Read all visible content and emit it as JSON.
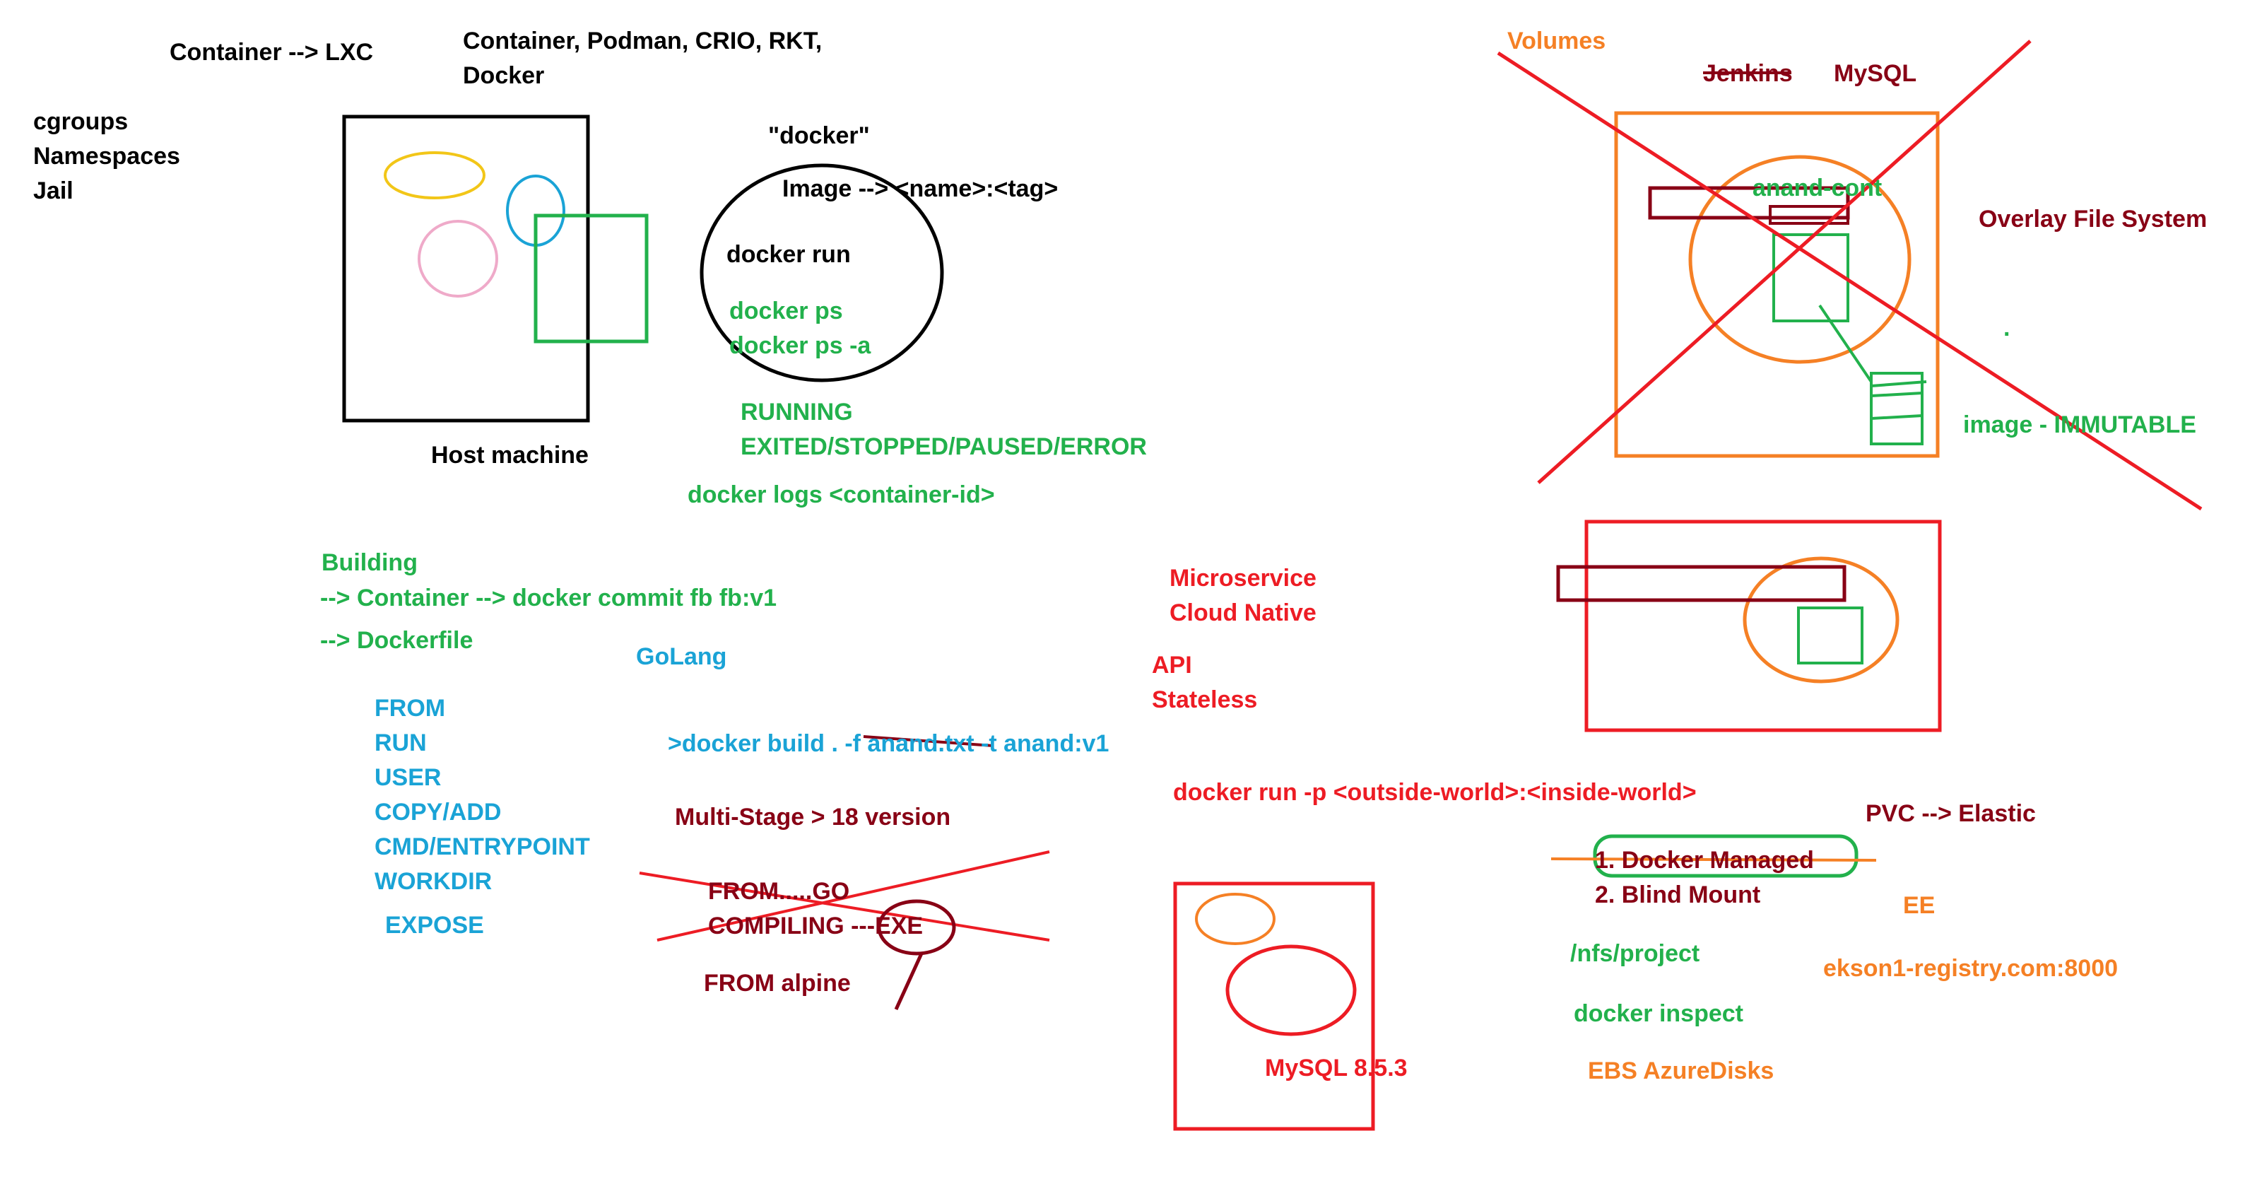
{
  "colors": {
    "black": "#000000",
    "green": "#22b14c",
    "blue": "#1aa3d6",
    "dark_red": "#880015",
    "red": "#ed1c24",
    "orange": "#f58025",
    "yellow": "#f2c618",
    "pink": "#efaac9"
  },
  "top_left": {
    "container_lxc": "Container --> LXC",
    "runtimes_line1": "Container, Podman, CRIO, RKT,",
    "runtimes_line2": "Docker",
    "kernel_features": [
      "cgroups",
      "Namespaces",
      "Jail"
    ],
    "host_machine": "Host machine"
  },
  "docker_basics": {
    "docker_quoted": "\"docker\"",
    "image_format": "Image --> <name>:<tag>",
    "docker_run": "docker run",
    "docker_ps": "docker ps",
    "docker_ps_a": "docker ps -a",
    "state_running": "RUNNING",
    "state_others": "EXITED/STOPPED/PAUSED/ERROR",
    "docker_logs": "docker logs <container-id>"
  },
  "building": {
    "heading": "Building",
    "via_commit": "--> Container --> docker commit fb fb:v1",
    "via_dockerfile": "--> Dockerfile",
    "golang": "GoLang",
    "instructions": [
      "FROM",
      "RUN",
      "USER",
      "COPY/ADD",
      "CMD/ENTRYPOINT",
      "WORKDIR"
    ],
    "expose": "EXPOSE",
    "build_command": ">docker build . -f anand.txt -t anand:v1",
    "multistage": "Multi-Stage > 18 version",
    "stage_from_go": "FROM.....GO",
    "stage_compiling": "COMPILING ---EXE",
    "stage_from_alpine": "FROM alpine"
  },
  "concepts": {
    "microservice": "Microservice",
    "cloud_native": "Cloud Native",
    "api": "API",
    "stateless": "Stateless",
    "port_mapping": "docker run -p <outside-world>:<inside-world>",
    "mysql_version": "MySQL 8.5.3"
  },
  "volumes": {
    "title": "Volumes",
    "jenkins": "Jenkins",
    "mysql": "MySQL",
    "container_name": "anand-cont",
    "overlay_fs": "Overlay File System",
    "dot": ".",
    "image_immutable": "image - IMMUTABLE",
    "pvc_elastic": "PVC --> Elastic",
    "docker_managed": "1. Docker Managed",
    "blind_mount": "2. Blind Mount",
    "ee": "EE",
    "nfs_project": "/nfs/project",
    "registry": "ekson1-registry.com:8000",
    "docker_inspect": "docker inspect",
    "ebs_azure": "EBS AzureDisks"
  }
}
